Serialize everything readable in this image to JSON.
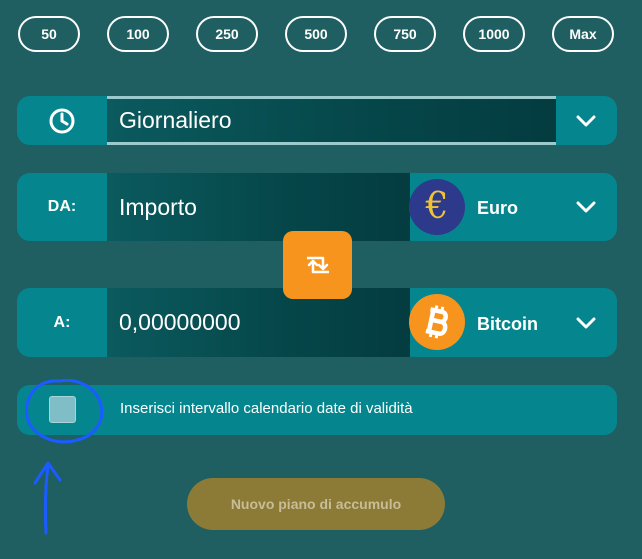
{
  "amount_chips": [
    "50",
    "100",
    "250",
    "500",
    "750",
    "1000",
    "Max"
  ],
  "frequency": {
    "icon": "clock-icon",
    "value": "Giornaliero"
  },
  "from": {
    "label": "DA:",
    "placeholder": "Importo",
    "currency_symbol": "€",
    "currency_name": "Euro",
    "icon": "euro-icon"
  },
  "to": {
    "label": "A:",
    "value": "0,00000000",
    "currency_name": "Bitcoin",
    "icon": "bitcoin-icon"
  },
  "validity": {
    "label": "Inserisci intervallo calendario date di validità",
    "checked": false
  },
  "submit_label": "Nuovo piano di accumulo",
  "colors": {
    "background": "#1f5f62",
    "row": "#05868f",
    "accent_orange": "#f7941d",
    "euro": "#2d3a8c",
    "euro_symbol": "#f2c230",
    "submit": "#8c7a37",
    "annotation": "#1a5cff"
  }
}
